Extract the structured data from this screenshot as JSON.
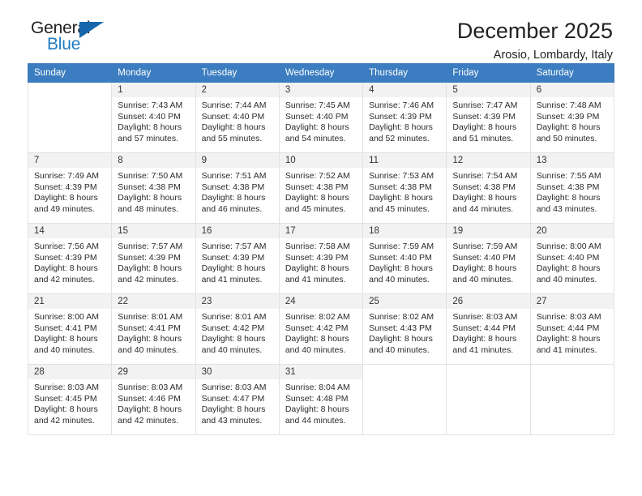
{
  "brand": {
    "name_part1": "General",
    "name_part2": "Blue",
    "triangle_icon": "triangle-icon",
    "colors": {
      "text": "#231f20",
      "accent": "#1f7bc1",
      "triangle": "#1766ab"
    }
  },
  "header": {
    "title": "December 2025",
    "subtitle": "Arosio, Lombardy, Italy"
  },
  "calendar": {
    "header_bg": "#3b7dc0",
    "weekdays": [
      "Sunday",
      "Monday",
      "Tuesday",
      "Wednesday",
      "Thursday",
      "Friday",
      "Saturday"
    ],
    "weeks": [
      [
        {
          "day": "",
          "sunrise": "",
          "sunset": "",
          "daylight_line1": "",
          "daylight_line2": ""
        },
        {
          "day": "1",
          "sunrise": "Sunrise: 7:43 AM",
          "sunset": "Sunset: 4:40 PM",
          "daylight_line1": "Daylight: 8 hours",
          "daylight_line2": "and 57 minutes."
        },
        {
          "day": "2",
          "sunrise": "Sunrise: 7:44 AM",
          "sunset": "Sunset: 4:40 PM",
          "daylight_line1": "Daylight: 8 hours",
          "daylight_line2": "and 55 minutes."
        },
        {
          "day": "3",
          "sunrise": "Sunrise: 7:45 AM",
          "sunset": "Sunset: 4:40 PM",
          "daylight_line1": "Daylight: 8 hours",
          "daylight_line2": "and 54 minutes."
        },
        {
          "day": "4",
          "sunrise": "Sunrise: 7:46 AM",
          "sunset": "Sunset: 4:39 PM",
          "daylight_line1": "Daylight: 8 hours",
          "daylight_line2": "and 52 minutes."
        },
        {
          "day": "5",
          "sunrise": "Sunrise: 7:47 AM",
          "sunset": "Sunset: 4:39 PM",
          "daylight_line1": "Daylight: 8 hours",
          "daylight_line2": "and 51 minutes."
        },
        {
          "day": "6",
          "sunrise": "Sunrise: 7:48 AM",
          "sunset": "Sunset: 4:39 PM",
          "daylight_line1": "Daylight: 8 hours",
          "daylight_line2": "and 50 minutes."
        }
      ],
      [
        {
          "day": "7",
          "sunrise": "Sunrise: 7:49 AM",
          "sunset": "Sunset: 4:39 PM",
          "daylight_line1": "Daylight: 8 hours",
          "daylight_line2": "and 49 minutes."
        },
        {
          "day": "8",
          "sunrise": "Sunrise: 7:50 AM",
          "sunset": "Sunset: 4:38 PM",
          "daylight_line1": "Daylight: 8 hours",
          "daylight_line2": "and 48 minutes."
        },
        {
          "day": "9",
          "sunrise": "Sunrise: 7:51 AM",
          "sunset": "Sunset: 4:38 PM",
          "daylight_line1": "Daylight: 8 hours",
          "daylight_line2": "and 46 minutes."
        },
        {
          "day": "10",
          "sunrise": "Sunrise: 7:52 AM",
          "sunset": "Sunset: 4:38 PM",
          "daylight_line1": "Daylight: 8 hours",
          "daylight_line2": "and 45 minutes."
        },
        {
          "day": "11",
          "sunrise": "Sunrise: 7:53 AM",
          "sunset": "Sunset: 4:38 PM",
          "daylight_line1": "Daylight: 8 hours",
          "daylight_line2": "and 45 minutes."
        },
        {
          "day": "12",
          "sunrise": "Sunrise: 7:54 AM",
          "sunset": "Sunset: 4:38 PM",
          "daylight_line1": "Daylight: 8 hours",
          "daylight_line2": "and 44 minutes."
        },
        {
          "day": "13",
          "sunrise": "Sunrise: 7:55 AM",
          "sunset": "Sunset: 4:38 PM",
          "daylight_line1": "Daylight: 8 hours",
          "daylight_line2": "and 43 minutes."
        }
      ],
      [
        {
          "day": "14",
          "sunrise": "Sunrise: 7:56 AM",
          "sunset": "Sunset: 4:39 PM",
          "daylight_line1": "Daylight: 8 hours",
          "daylight_line2": "and 42 minutes."
        },
        {
          "day": "15",
          "sunrise": "Sunrise: 7:57 AM",
          "sunset": "Sunset: 4:39 PM",
          "daylight_line1": "Daylight: 8 hours",
          "daylight_line2": "and 42 minutes."
        },
        {
          "day": "16",
          "sunrise": "Sunrise: 7:57 AM",
          "sunset": "Sunset: 4:39 PM",
          "daylight_line1": "Daylight: 8 hours",
          "daylight_line2": "and 41 minutes."
        },
        {
          "day": "17",
          "sunrise": "Sunrise: 7:58 AM",
          "sunset": "Sunset: 4:39 PM",
          "daylight_line1": "Daylight: 8 hours",
          "daylight_line2": "and 41 minutes."
        },
        {
          "day": "18",
          "sunrise": "Sunrise: 7:59 AM",
          "sunset": "Sunset: 4:40 PM",
          "daylight_line1": "Daylight: 8 hours",
          "daylight_line2": "and 40 minutes."
        },
        {
          "day": "19",
          "sunrise": "Sunrise: 7:59 AM",
          "sunset": "Sunset: 4:40 PM",
          "daylight_line1": "Daylight: 8 hours",
          "daylight_line2": "and 40 minutes."
        },
        {
          "day": "20",
          "sunrise": "Sunrise: 8:00 AM",
          "sunset": "Sunset: 4:40 PM",
          "daylight_line1": "Daylight: 8 hours",
          "daylight_line2": "and 40 minutes."
        }
      ],
      [
        {
          "day": "21",
          "sunrise": "Sunrise: 8:00 AM",
          "sunset": "Sunset: 4:41 PM",
          "daylight_line1": "Daylight: 8 hours",
          "daylight_line2": "and 40 minutes."
        },
        {
          "day": "22",
          "sunrise": "Sunrise: 8:01 AM",
          "sunset": "Sunset: 4:41 PM",
          "daylight_line1": "Daylight: 8 hours",
          "daylight_line2": "and 40 minutes."
        },
        {
          "day": "23",
          "sunrise": "Sunrise: 8:01 AM",
          "sunset": "Sunset: 4:42 PM",
          "daylight_line1": "Daylight: 8 hours",
          "daylight_line2": "and 40 minutes."
        },
        {
          "day": "24",
          "sunrise": "Sunrise: 8:02 AM",
          "sunset": "Sunset: 4:42 PM",
          "daylight_line1": "Daylight: 8 hours",
          "daylight_line2": "and 40 minutes."
        },
        {
          "day": "25",
          "sunrise": "Sunrise: 8:02 AM",
          "sunset": "Sunset: 4:43 PM",
          "daylight_line1": "Daylight: 8 hours",
          "daylight_line2": "and 40 minutes."
        },
        {
          "day": "26",
          "sunrise": "Sunrise: 8:03 AM",
          "sunset": "Sunset: 4:44 PM",
          "daylight_line1": "Daylight: 8 hours",
          "daylight_line2": "and 41 minutes."
        },
        {
          "day": "27",
          "sunrise": "Sunrise: 8:03 AM",
          "sunset": "Sunset: 4:44 PM",
          "daylight_line1": "Daylight: 8 hours",
          "daylight_line2": "and 41 minutes."
        }
      ],
      [
        {
          "day": "28",
          "sunrise": "Sunrise: 8:03 AM",
          "sunset": "Sunset: 4:45 PM",
          "daylight_line1": "Daylight: 8 hours",
          "daylight_line2": "and 42 minutes."
        },
        {
          "day": "29",
          "sunrise": "Sunrise: 8:03 AM",
          "sunset": "Sunset: 4:46 PM",
          "daylight_line1": "Daylight: 8 hours",
          "daylight_line2": "and 42 minutes."
        },
        {
          "day": "30",
          "sunrise": "Sunrise: 8:03 AM",
          "sunset": "Sunset: 4:47 PM",
          "daylight_line1": "Daylight: 8 hours",
          "daylight_line2": "and 43 minutes."
        },
        {
          "day": "31",
          "sunrise": "Sunrise: 8:04 AM",
          "sunset": "Sunset: 4:48 PM",
          "daylight_line1": "Daylight: 8 hours",
          "daylight_line2": "and 44 minutes."
        },
        {
          "day": "",
          "sunrise": "",
          "sunset": "",
          "daylight_line1": "",
          "daylight_line2": ""
        },
        {
          "day": "",
          "sunrise": "",
          "sunset": "",
          "daylight_line1": "",
          "daylight_line2": ""
        },
        {
          "day": "",
          "sunrise": "",
          "sunset": "",
          "daylight_line1": "",
          "daylight_line2": ""
        }
      ]
    ]
  }
}
